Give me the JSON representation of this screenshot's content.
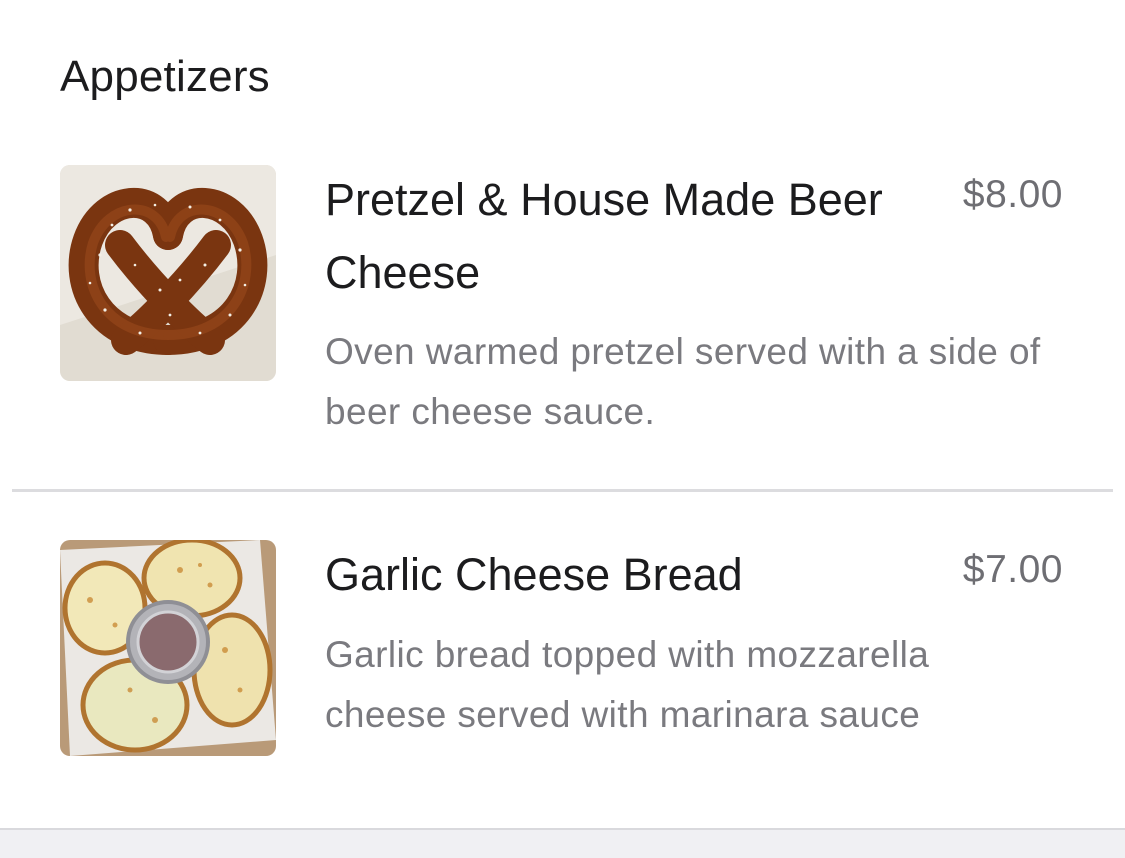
{
  "section": {
    "title": "Appetizers"
  },
  "items": [
    {
      "name": "Pretzel & House Made Beer Cheese",
      "price": "$8.00",
      "description": "Oven warmed pretzel served with a side of beer cheese sauce.",
      "image_icon": "pretzel-photo"
    },
    {
      "name": "Garlic Cheese Bread",
      "price": "$7.00",
      "description": "Garlic bread topped with mozzarella cheese served with marinara sauce",
      "image_icon": "garlic-bread-photo"
    }
  ],
  "colors": {
    "title_text": "#1c1c1e",
    "price_text": "#6e6e73",
    "description_text": "#7a7a7f",
    "divider": "#dcdcdf"
  }
}
